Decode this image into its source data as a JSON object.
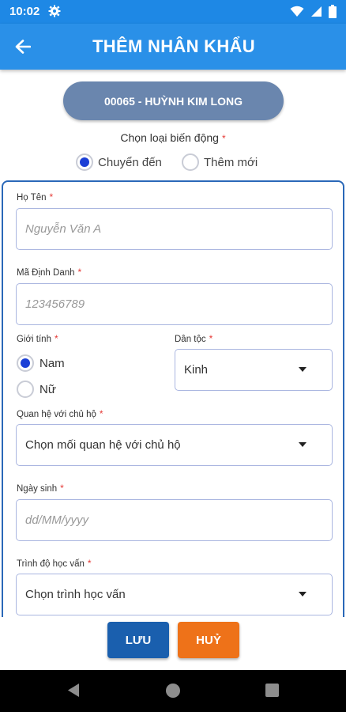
{
  "status_bar": {
    "time": "10:02"
  },
  "app_bar": {
    "title": "THÊM NHÂN KHẨU"
  },
  "household": {
    "label": "00065 - HUỲNH KIM LONG"
  },
  "change_type": {
    "label": "Chọn loại biến động",
    "required_mark": "*",
    "options": [
      {
        "label": "Chuyển đến",
        "selected": true
      },
      {
        "label": "Thêm mới",
        "selected": false
      }
    ]
  },
  "form": {
    "full_name": {
      "label": "Họ Tên",
      "required_mark": "*",
      "placeholder": "Nguyễn Văn A"
    },
    "id_code": {
      "label": "Mã Định Danh",
      "required_mark": "*",
      "placeholder": "123456789"
    },
    "gender": {
      "label": "Giới tính",
      "required_mark": "*",
      "options": [
        {
          "label": "Nam",
          "selected": true
        },
        {
          "label": "Nữ",
          "selected": false
        }
      ]
    },
    "ethnicity": {
      "label": "Dân tộc",
      "required_mark": "*",
      "value": "Kinh"
    },
    "relationship": {
      "label": "Quan hệ với chủ hộ",
      "required_mark": "*",
      "value": "Chọn mối quan hệ với chủ hộ"
    },
    "birth_date": {
      "label": "Ngày sinh",
      "required_mark": "*",
      "placeholder": "dd/MM/yyyy"
    },
    "education": {
      "label": "Trình độ học vấn",
      "required_mark": "*",
      "value": "Chọn trình học vấn"
    }
  },
  "buttons": {
    "save": "LƯU",
    "cancel": "HUỶ"
  },
  "colors": {
    "app_bar": "#2a90e8",
    "pill": "#6a86ae",
    "save": "#1a5fae",
    "cancel": "#ee7219",
    "radio_selected": "#1b3fd6",
    "required": "#e53935"
  }
}
